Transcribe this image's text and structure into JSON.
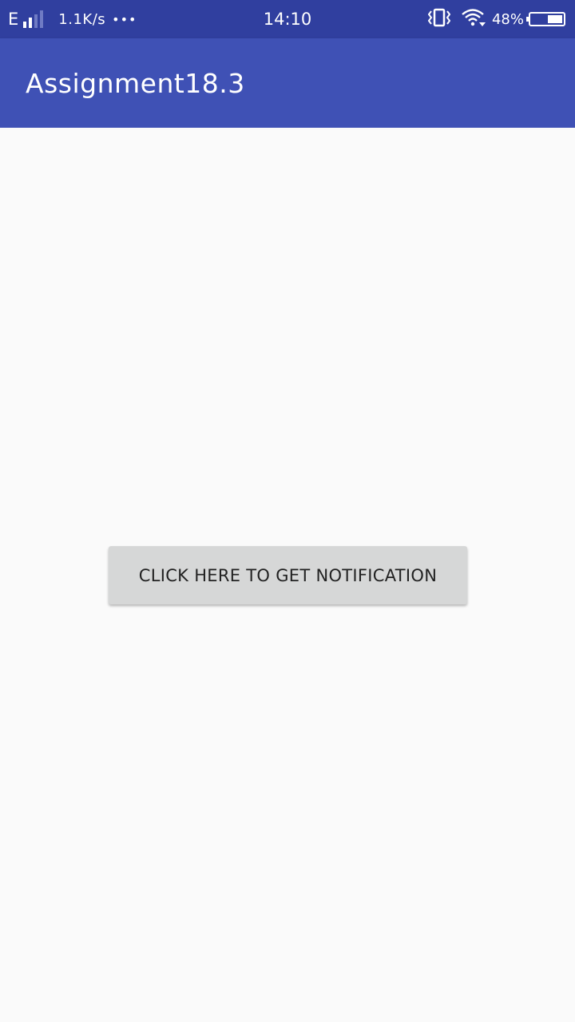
{
  "status_bar": {
    "network_type": "E",
    "signal_bars": 4,
    "signal_active": 2,
    "net_speed": "1.1K/s",
    "more_dots": "•••",
    "time": "14:10",
    "battery_percent": "48%",
    "battery_level": 0.48,
    "icons": [
      "vibrate-icon",
      "wifi-icon",
      "battery-icon"
    ]
  },
  "app_bar": {
    "title": "Assignment18.3"
  },
  "main": {
    "button_label": "CLICK HERE TO GET NOTIFICATION"
  },
  "colors": {
    "status_bar": "#303f9f",
    "app_bar": "#3f51b5",
    "background": "#fafafa",
    "button": "#d6d7d7"
  }
}
